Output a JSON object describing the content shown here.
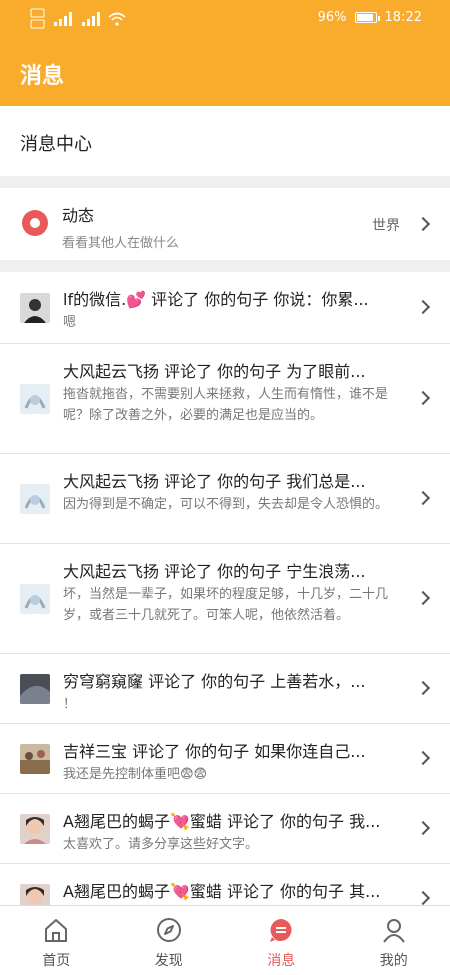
{
  "status_bar": {
    "battery": "96%",
    "time": "18:22"
  },
  "header": {
    "title": "消息"
  },
  "center": {
    "title": "消息中心"
  },
  "dynamics": {
    "title": "动态",
    "subtitle": "看看其他人在做什么",
    "right_label": "世界"
  },
  "messages": [
    {
      "title": "lf的微信.💕 评论了 你的句子 你说：你累...",
      "body": "嗯"
    },
    {
      "title": "大风起云飞扬 评论了 你的句子 为了眼前...",
      "body": "拖沓就拖沓，不需要别人来拯救，人生而有惰性，谁不是呢？除了改善之外，必要的满足也是应当的。"
    },
    {
      "title": "大风起云飞扬 评论了 你的句子 我们总是...",
      "body": "因为得到是不确定，可以不得到，失去却是令人恐惧的。"
    },
    {
      "title": "大风起云飞扬 评论了 你的句子 宁生浪荡...",
      "body": "坏，当然是一辈子，如果坏的程度足够，十几岁，二十几岁，或者三十几就死了。可笨人呢，他依然活着。"
    },
    {
      "title": "穷穹窮窺窿 评论了 你的句子 上善若水，...",
      "body": "！"
    },
    {
      "title": "吉祥三宝 评论了 你的句子 如果你连自己...",
      "body": "我还是先控制体重吧😨😨"
    },
    {
      "title": "A翘尾巴的蝎子💘蜜蜡 评论了 你的句子 我...",
      "body": "太喜欢了。请多分享这些好文字。"
    },
    {
      "title": "A翘尾巴的蝎子💘蜜蜡 评论了 你的句子 其...",
      "body": ""
    }
  ],
  "nav": [
    {
      "label": "首页",
      "icon": "home-icon"
    },
    {
      "label": "发现",
      "icon": "compass-icon"
    },
    {
      "label": "消息",
      "icon": "message-icon",
      "active": true
    },
    {
      "label": "我的",
      "icon": "profile-icon"
    }
  ],
  "colors": {
    "primary": "#f9ab2b",
    "accent": "#e85a5a"
  }
}
